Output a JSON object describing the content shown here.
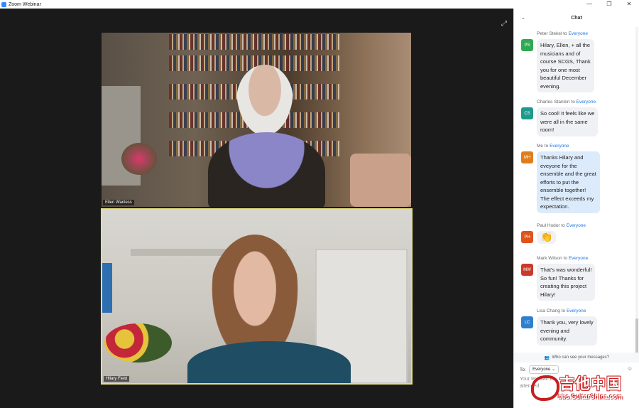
{
  "window": {
    "title": "Zoom Webinar",
    "controls": [
      "—",
      "❐",
      "✕"
    ]
  },
  "stage": {
    "expand_icon": "⤢",
    "videos": [
      {
        "name": "Ellen Wanless",
        "active_speaker": false
      },
      {
        "name": "Hilary Field",
        "active_speaker": true
      }
    ]
  },
  "chat": {
    "title": "Chat",
    "collapse_icon": "⌄",
    "messages": [
      {
        "sender": "Peter Stekel",
        "to": "Everyone",
        "initials": "PS",
        "avatar_color": "#2eaa55",
        "text_lines": [
          "Hilary, Ellen, + all the",
          "musicians and of",
          "course SCGS, Thank",
          "you for one most",
          "beautiful December",
          "evening."
        ],
        "is_me": false
      },
      {
        "sender": "Charles Stanton",
        "to": "Everyone",
        "initials": "CS",
        "avatar_color": "#1e9a8c",
        "text_lines": [
          "So cool! It feels like we",
          "were all in the same",
          "room!"
        ],
        "is_me": false
      },
      {
        "sender": "Me",
        "to": "Everyone",
        "initials": "MH",
        "avatar_color": "#e07d1a",
        "text_lines": [
          "Thanks Hilary and",
          "eveyone for the",
          "ensemble and the great",
          "efforts to put the",
          "ensemble together!",
          "The effect exceeds my",
          "expectation."
        ],
        "is_me": true
      },
      {
        "sender": "Paul Hodor",
        "to": "Everyone",
        "initials": "PH",
        "avatar_color": "#e0521a",
        "text_lines": [
          "👏"
        ],
        "is_me": false
      },
      {
        "sender": "Mark Wilson",
        "to": "Everyone",
        "initials": "MW",
        "avatar_color": "#c93a2a",
        "text_lines": [
          "That's was wonderful!",
          "So fun! Thanks for",
          "creating this project",
          "Hilary!"
        ],
        "is_me": false
      },
      {
        "sender": "Lisa Chang",
        "to": "Everyone",
        "initials": "LC",
        "avatar_color": "#2f7fcf",
        "text_lines": [
          "Thank you, very lovely",
          "evening and",
          "community."
        ],
        "is_me": false
      }
    ],
    "who_can_see": "Who can see your messages?",
    "compose": {
      "to_label": "To:",
      "recipient": "Everyone",
      "placeholder_lines": [
        "Your text can be",
        "attended"
      ],
      "emoji_icon": "☺"
    }
  },
  "watermark": {
    "main": "吉他中国",
    "sub": "bbs.GuitarChina.com"
  }
}
